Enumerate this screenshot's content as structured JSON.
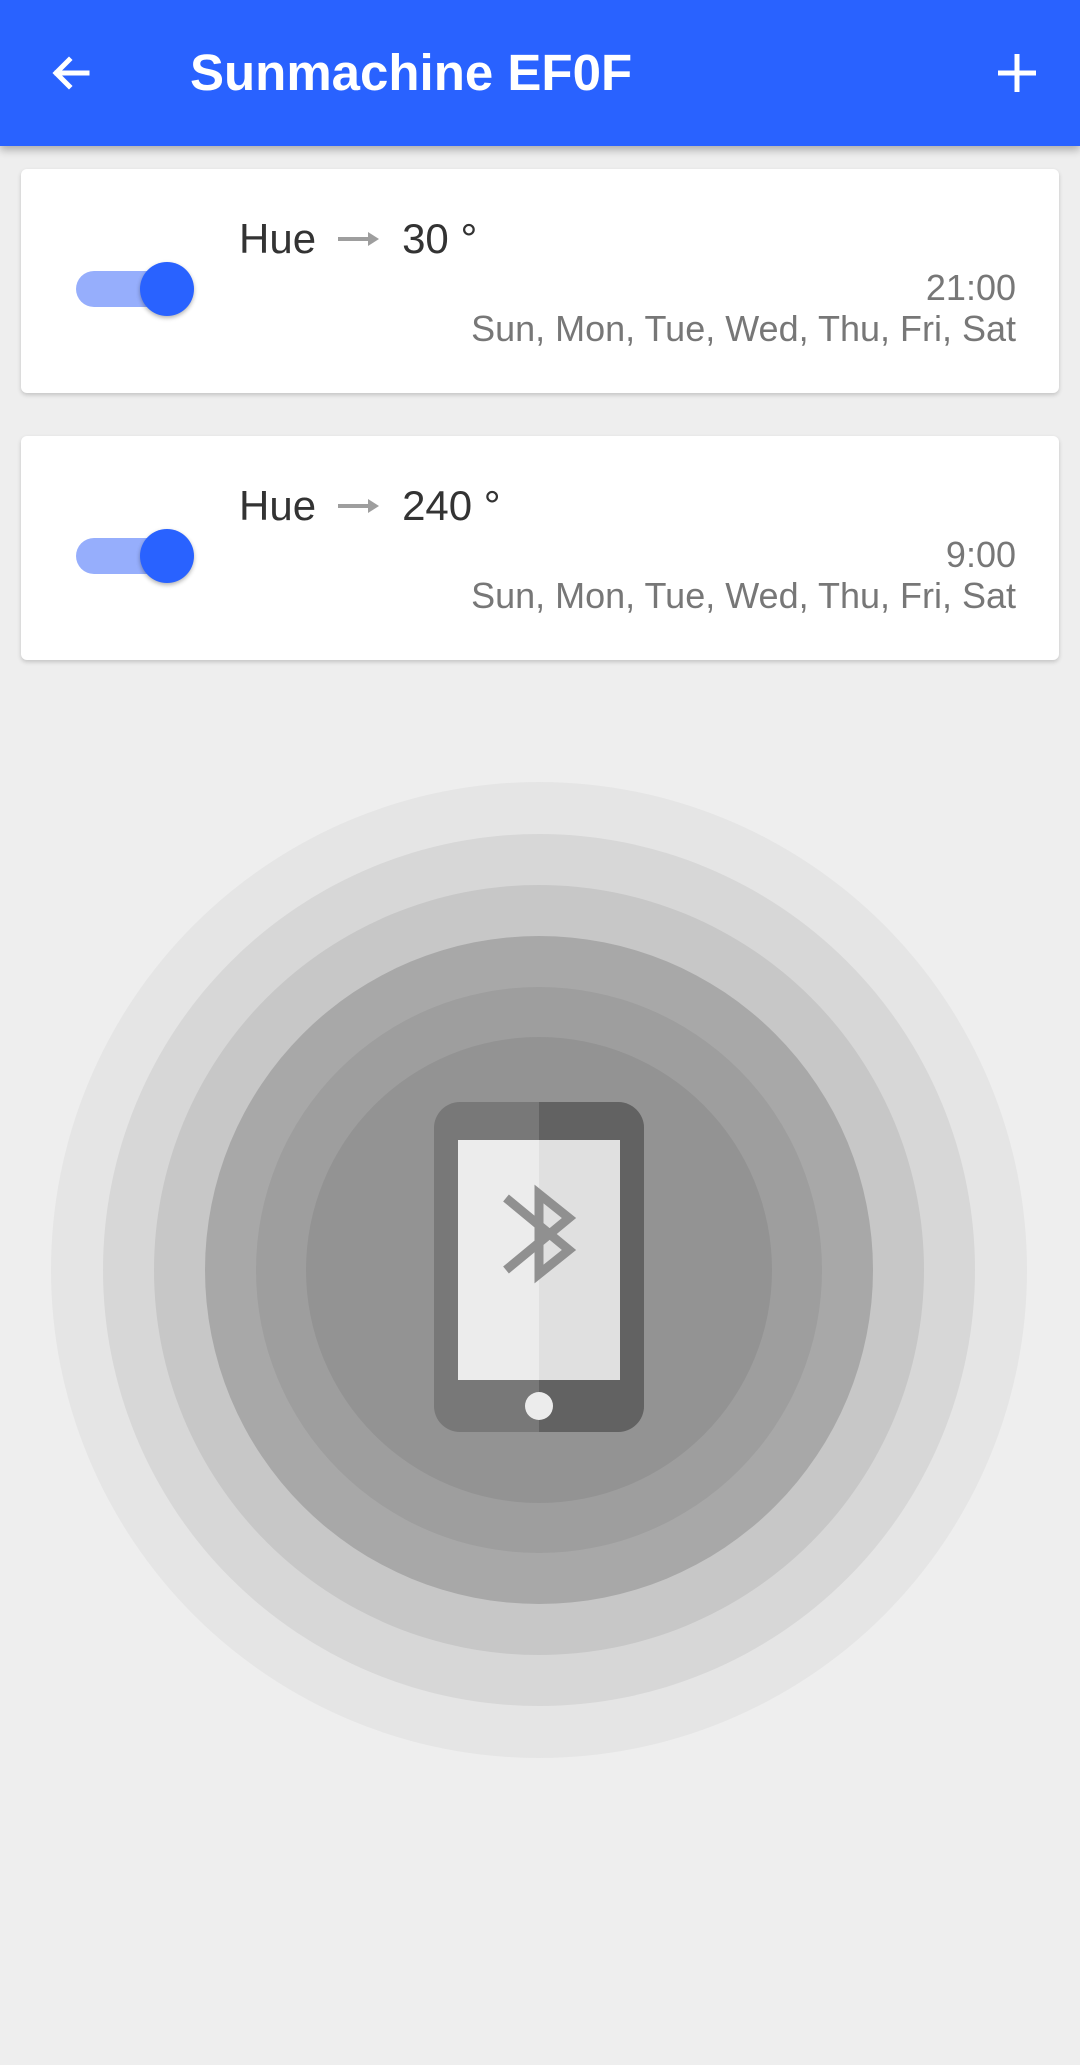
{
  "appbar": {
    "title": "Sunmachine EF0F",
    "back_icon": "arrow-left-icon",
    "add_icon": "plus-icon",
    "color": "#2962ff"
  },
  "rules": [
    {
      "enabled": true,
      "property": "Hue",
      "value": "30 °",
      "time": "21:00",
      "days": "Sun, Mon, Tue, Wed, Thu, Fri, Sat"
    },
    {
      "enabled": true,
      "property": "Hue",
      "value": "240 °",
      "time": "9:00",
      "days": "Sun, Mon, Tue, Wed, Thu, Fri, Sat"
    }
  ],
  "scanner": {
    "icon": "bluetooth-phone-icon",
    "ring_colors": [
      "#e5e5e5",
      "#d7d7d7",
      "#c7c7c7",
      "#a8a8a8",
      "#9e9e9e",
      "#939393"
    ]
  }
}
